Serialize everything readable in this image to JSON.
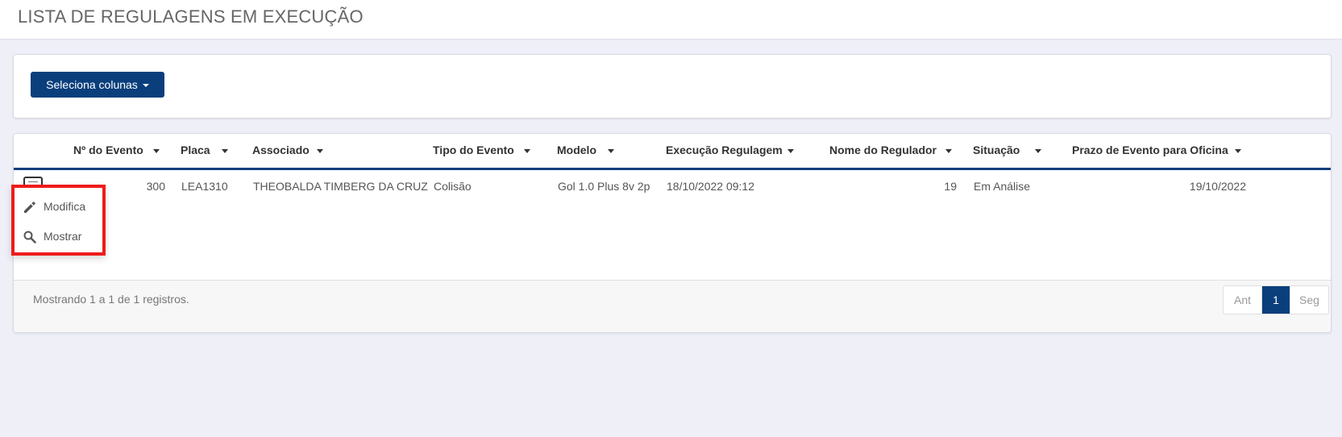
{
  "page": {
    "title": "LISTA DE REGULAGENS EM EXECUÇÃO"
  },
  "toolbar": {
    "select_columns_label": "Seleciona colunas"
  },
  "table": {
    "columns": [
      "Nº do Evento",
      "Placa",
      "Associado",
      "Tipo do Evento",
      "Modelo",
      "Execução Regulagem",
      "Nome do Regulador",
      "Situação",
      "Prazo de Evento para Oficina"
    ],
    "rows": [
      {
        "numero_evento": "300",
        "placa": "LEA1310",
        "associado": "THEOBALDA TIMBERG DA CRUZ",
        "tipo_evento": "Colisão",
        "modelo": "Gol 1.0 Plus 8v 2p",
        "execucao_regulagem": "18/10/2022 09:12",
        "nome_regulador": "19",
        "situacao": "Em Análise",
        "prazo_oficina": "19/10/2022"
      }
    ]
  },
  "row_menu": {
    "items": [
      {
        "label": "Modifica",
        "icon": "pencil-icon"
      },
      {
        "label": "Mostrar",
        "icon": "search-icon"
      }
    ],
    "highlight_color": "#ee1c1c"
  },
  "footer": {
    "info": "Mostrando 1 a 1 de 1 registros.",
    "pagination": {
      "prev": "Ant",
      "current": "1",
      "next": "Seg"
    }
  },
  "colors": {
    "primary": "#0a3f7c",
    "background": "#eeeff7"
  }
}
